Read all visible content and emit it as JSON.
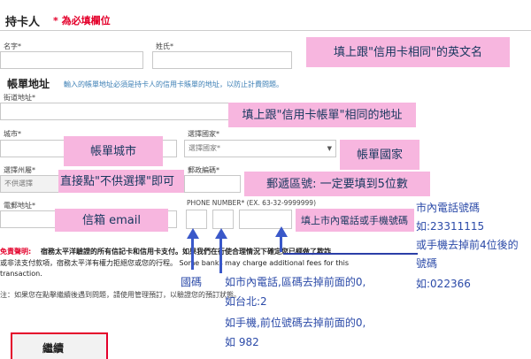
{
  "form": {
    "section_title": "持卡人",
    "required_note": "* 為必填欄位",
    "first_name_label": "名字*",
    "last_name_label": "姓氏*",
    "billing_title": "帳單地址",
    "billing_note": "輸入的帳單地址必須是持卡人的信用卡賬單的地址，以防止計費問題。",
    "street_label": "街道地址*",
    "city_label": "城市*",
    "country_label": "選擇國家*",
    "country_value": "選擇國家*",
    "state_label": "選擇州屬*",
    "state_value": "不供選擇",
    "postal_label": "郵政編碼*",
    "email_label": "電郵地址*",
    "phone_label": "PHONE NUMBER* (EX. 63-32-9999999)",
    "disclaimer_title": "免責聲明:",
    "disclaimer_line1": "宿務太平洋驗證的所有信記卡和信用卡支付。如果我們在行使合理情況下確定您已經做了欺詐",
    "disclaimer_line2": "或非法支付款項，宿務太平洋有權力拒絕您或您的行程。 Some banks may charge additional fees for this",
    "disclaimer_line3": "transaction.",
    "note_text": "注：如果您在點擊繼續後遇到問題，請使用管理預訂，以驗證您的預訂狀態。",
    "continue_label": "繼續"
  },
  "annotations": {
    "name_hint": "填上跟\"信用卡相同\"的英文名",
    "address_hint": "填上跟\"信用卡帳單\"相同的地址",
    "city_hint": "帳單城市",
    "country_hint": "帳單國家",
    "state_hint": "直接點\"不供選擇\"即可",
    "postal_hint": "郵遞區號: 一定要填到5位數",
    "email_hint": "信箱 email",
    "phone_hint": "填上市內電話或手機號碼",
    "country_code": "國碼",
    "area_code_line1": "如市內電話,區碼去掉前面的0,",
    "area_code_line2": "如台北:2",
    "area_code_line3": "如手機,前位號碼去掉前面的0,",
    "area_code_line4": "如 982",
    "number_line1": "市內電話號碼",
    "number_line2": "如:23311115",
    "number_line3": "或手機去掉前4位後的",
    "number_line4": "號碼",
    "number_line5": "如:022366"
  },
  "colors": {
    "highlight": "#f7b6df",
    "annotation_blue": "#2b4aa8",
    "required_red": "#e4002b"
  }
}
